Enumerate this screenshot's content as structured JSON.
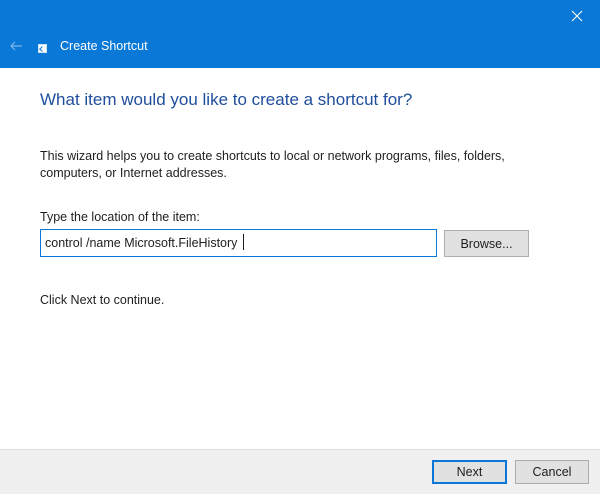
{
  "window": {
    "title": "Create Shortcut",
    "accent_color": "#0a78d7",
    "icons": {
      "back": "back-arrow-icon",
      "close": "close-icon",
      "app": "shortcut-icon"
    }
  },
  "main": {
    "heading": "What item would you like to create a shortcut for?",
    "description": "This wizard helps you to create shortcuts to local or network programs, files, folders, computers, or Internet addresses.",
    "location_label": "Type the location of the item:",
    "location_value": "control /name Microsoft.FileHistory",
    "browse_label": "Browse...",
    "continue_text": "Click Next to continue."
  },
  "footer": {
    "next_label": "Next",
    "cancel_label": "Cancel"
  }
}
